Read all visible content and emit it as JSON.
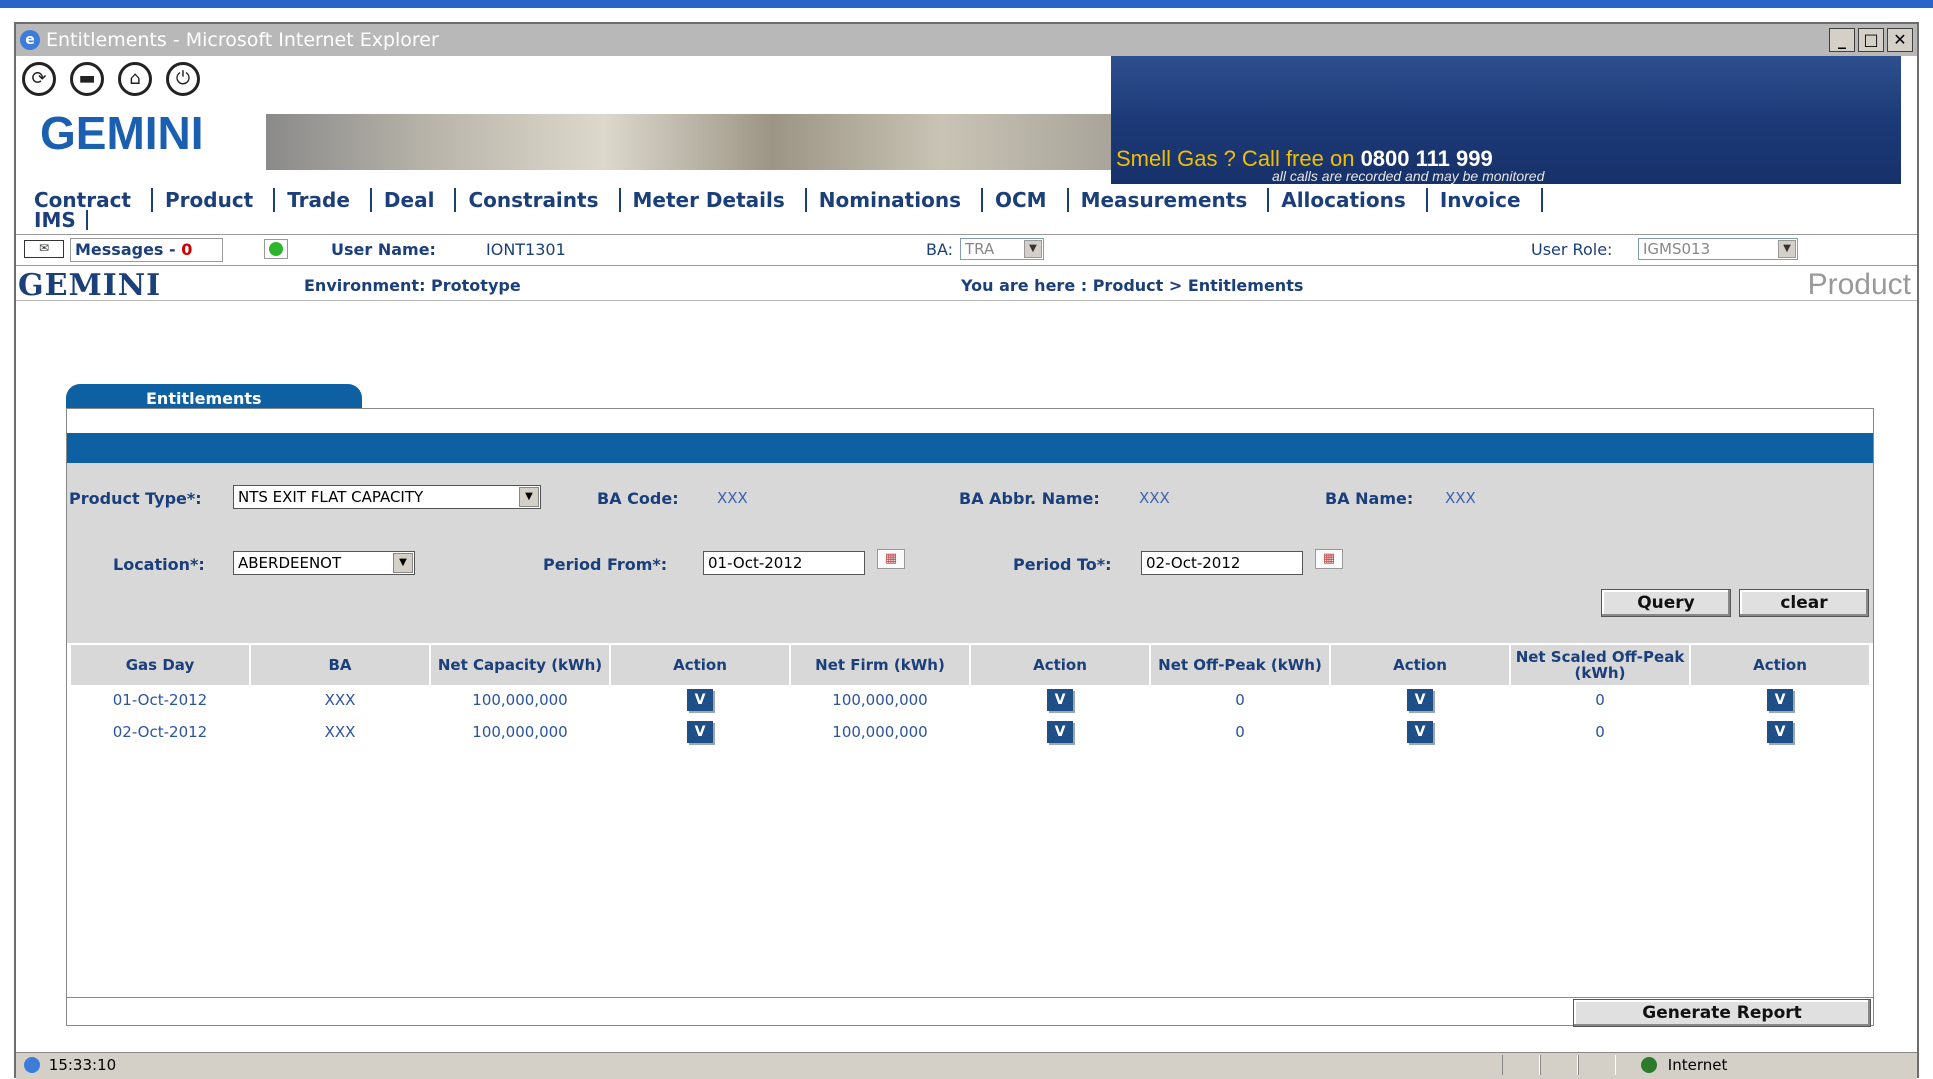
{
  "window": {
    "title": "Entitlements - Microsoft Internet Explorer"
  },
  "header": {
    "logo": "GEMINI",
    "banner_text": "Smell Gas ? Call free on",
    "banner_phone": "0800 111 999",
    "banner_sub": "all calls are recorded and may be monitored",
    "icons": [
      "refresh-icon",
      "print-icon",
      "home-icon",
      "power-icon"
    ]
  },
  "menu": {
    "items": [
      "Contract",
      "Product",
      "Trade",
      "Deal",
      "Constraints",
      "Meter Details",
      "Nominations",
      "OCM",
      "Measurements",
      "Allocations",
      "Invoice"
    ],
    "ims": "IMS"
  },
  "infobar": {
    "messages_label": "Messages -",
    "messages_count": "0",
    "username_label": "User Name:",
    "username": "IONT1301",
    "ba_label": "BA:",
    "ba_value": "TRA",
    "user_role_label": "User Role:",
    "user_role": "IGMS013"
  },
  "brandbar": {
    "logo": "GEMINI",
    "environment": "Environment: Prototype",
    "breadcrumb": "You are here : Product > Entitlements",
    "section": "Product"
  },
  "tab": {
    "label": "Entitlements"
  },
  "form": {
    "product_type_label": "Product Type*:",
    "product_type": "NTS EXIT FLAT CAPACITY",
    "ba_code_label": "BA Code:",
    "ba_code": "XXX",
    "ba_abbr_label": "BA Abbr. Name:",
    "ba_abbr": "XXX",
    "ba_name_label": "BA Name:",
    "ba_name": "XXX",
    "location_label": "Location*:",
    "location": "ABERDEENOT",
    "period_from_label": "Period From*:",
    "period_from": "01-Oct-2012",
    "period_to_label": "Period To*:",
    "period_to": "02-Oct-2012",
    "query_label": "Query",
    "clear_label": "clear"
  },
  "table": {
    "headers": [
      "Gas Day",
      "BA",
      "Net Capacity (kWh)",
      "Action",
      "Net Firm (kWh)",
      "Action",
      "Net Off-Peak (kWh)",
      "Action",
      "Net Scaled Off-Peak (kWh)",
      "Action"
    ],
    "rows": [
      {
        "gas_day": "01-Oct-2012",
        "ba": "XXX",
        "net_capacity": "100,000,000",
        "net_firm": "100,000,000",
        "net_off_peak": "0",
        "net_scaled": "0",
        "v": "V"
      },
      {
        "gas_day": "02-Oct-2012",
        "ba": "XXX",
        "net_capacity": "100,000,000",
        "net_firm": "100,000,000",
        "net_off_peak": "0",
        "net_scaled": "0",
        "v": "V"
      }
    ]
  },
  "footer": {
    "generate_report": "Generate Report"
  },
  "statusbar": {
    "time": "15:33:10",
    "zone": "Internet"
  }
}
